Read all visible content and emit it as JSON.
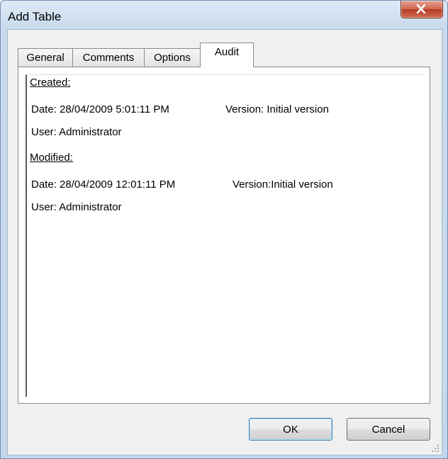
{
  "window": {
    "title": "Add Table"
  },
  "tabs": [
    {
      "label": "General"
    },
    {
      "label": "Comments"
    },
    {
      "label": "Options"
    },
    {
      "label": "Audit"
    }
  ],
  "audit": {
    "created": {
      "header": "Created:",
      "date": "Date: 28/04/2009 5:01:11 PM",
      "version": "Version: Initial version",
      "user": "User: Administrator"
    },
    "modified": {
      "header": "Modified:",
      "date": "Date: 28/04/2009 12:01:11 PM",
      "version": "Version:Initial version",
      "user": "User: Administrator"
    }
  },
  "buttons": {
    "ok": "OK",
    "cancel": "Cancel"
  },
  "icons": {
    "close": "close-icon",
    "grip": "resize-grip-icon"
  },
  "colors": {
    "close_button": "#c9533f",
    "title_bar": "#dfe9f5",
    "dialog_bg": "#f0f0f0"
  }
}
